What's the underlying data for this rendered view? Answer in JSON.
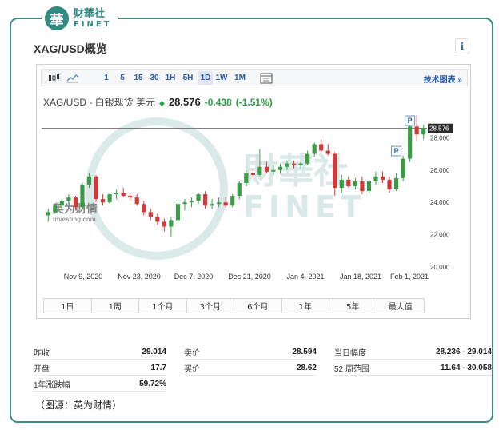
{
  "logo": {
    "badge_char": "華",
    "cn": "财華社",
    "en": "FINET"
  },
  "page_title": "XAG/USD概览",
  "info_label": "i",
  "toolbar": {
    "intervals": [
      "1",
      "5",
      "15",
      "30",
      "1H",
      "5H",
      "1D",
      "1W",
      "1M"
    ],
    "selected": "1D",
    "right_link": "技术图表 »"
  },
  "quote": {
    "symbol": "XAG/USD - 白银现货 美元",
    "arrow": "◆",
    "price": "28.576",
    "change": "-0.438",
    "change_pct": "(-1.51%)"
  },
  "chart_data": {
    "type": "candlestick",
    "x_ticks": [
      "Nov 9, 2020",
      "Nov 23, 2020",
      "Dec 7, 2020",
      "Dec 21, 2020",
      "Jan 4, 2021",
      "Jan 18, 2021",
      "Feb 1, 2021"
    ],
    "y_ticks": [
      "20.000",
      "22.000",
      "24.000",
      "26.000",
      "28.000"
    ],
    "ylim": [
      20,
      29.8
    ],
    "last_price_label": "28.576",
    "last_price": 28.576,
    "markers": [
      "P",
      "P"
    ],
    "watermark": {
      "cn": "財華社",
      "en": "FINET",
      "brand": "英为财情",
      "brand_en": "Investing.com"
    },
    "candles": [
      {
        "o": 23.2,
        "h": 23.6,
        "l": 22.8,
        "c": 23.4
      },
      {
        "o": 23.4,
        "h": 23.9,
        "l": 23.3,
        "c": 23.8
      },
      {
        "o": 23.8,
        "h": 24.2,
        "l": 23.6,
        "c": 24.1
      },
      {
        "o": 24.1,
        "h": 24.5,
        "l": 23.9,
        "c": 24.3
      },
      {
        "o": 24.3,
        "h": 24.4,
        "l": 23.5,
        "c": 23.7
      },
      {
        "o": 23.7,
        "h": 25.2,
        "l": 23.6,
        "c": 25.1
      },
      {
        "o": 25.1,
        "h": 25.8,
        "l": 24.9,
        "c": 25.6
      },
      {
        "o": 25.6,
        "h": 25.7,
        "l": 24.0,
        "c": 24.2
      },
      {
        "o": 24.2,
        "h": 24.5,
        "l": 23.8,
        "c": 24.0
      },
      {
        "o": 24.0,
        "h": 24.6,
        "l": 23.9,
        "c": 24.5
      },
      {
        "o": 24.5,
        "h": 24.8,
        "l": 24.2,
        "c": 24.6
      },
      {
        "o": 24.6,
        "h": 24.9,
        "l": 24.3,
        "c": 24.4
      },
      {
        "o": 24.4,
        "h": 24.6,
        "l": 24.1,
        "c": 24.3
      },
      {
        "o": 24.3,
        "h": 24.5,
        "l": 23.8,
        "c": 23.9
      },
      {
        "o": 23.9,
        "h": 24.1,
        "l": 23.2,
        "c": 23.4
      },
      {
        "o": 23.4,
        "h": 23.6,
        "l": 22.9,
        "c": 23.1
      },
      {
        "o": 23.1,
        "h": 23.3,
        "l": 22.6,
        "c": 22.8
      },
      {
        "o": 22.8,
        "h": 23.0,
        "l": 22.2,
        "c": 22.5
      },
      {
        "o": 22.5,
        "h": 23.1,
        "l": 21.9,
        "c": 22.9
      },
      {
        "o": 22.9,
        "h": 24.0,
        "l": 22.7,
        "c": 23.9
      },
      {
        "o": 23.9,
        "h": 24.2,
        "l": 23.5,
        "c": 24.0
      },
      {
        "o": 24.0,
        "h": 24.3,
        "l": 23.7,
        "c": 24.1
      },
      {
        "o": 24.1,
        "h": 24.6,
        "l": 23.9,
        "c": 24.5
      },
      {
        "o": 24.5,
        "h": 24.7,
        "l": 23.6,
        "c": 23.8
      },
      {
        "o": 23.8,
        "h": 24.2,
        "l": 23.6,
        "c": 23.9
      },
      {
        "o": 23.9,
        "h": 24.3,
        "l": 23.7,
        "c": 24.0
      },
      {
        "o": 24.0,
        "h": 24.3,
        "l": 23.7,
        "c": 23.8
      },
      {
        "o": 23.8,
        "h": 24.5,
        "l": 23.7,
        "c": 24.4
      },
      {
        "o": 24.4,
        "h": 25.3,
        "l": 24.2,
        "c": 25.2
      },
      {
        "o": 25.2,
        "h": 26.0,
        "l": 25.0,
        "c": 25.8
      },
      {
        "o": 25.8,
        "h": 26.1,
        "l": 25.5,
        "c": 25.7
      },
      {
        "o": 25.7,
        "h": 27.3,
        "l": 25.6,
        "c": 26.2
      },
      {
        "o": 26.2,
        "h": 26.5,
        "l": 25.8,
        "c": 25.9
      },
      {
        "o": 25.9,
        "h": 26.3,
        "l": 25.7,
        "c": 26.0
      },
      {
        "o": 26.0,
        "h": 26.4,
        "l": 25.8,
        "c": 26.2
      },
      {
        "o": 26.2,
        "h": 26.6,
        "l": 26.0,
        "c": 26.4
      },
      {
        "o": 26.4,
        "h": 26.6,
        "l": 26.1,
        "c": 26.3
      },
      {
        "o": 26.3,
        "h": 26.5,
        "l": 26.1,
        "c": 26.4
      },
      {
        "o": 26.4,
        "h": 27.2,
        "l": 26.3,
        "c": 27.0
      },
      {
        "o": 27.0,
        "h": 27.7,
        "l": 26.8,
        "c": 27.6
      },
      {
        "o": 27.6,
        "h": 27.9,
        "l": 27.1,
        "c": 27.2
      },
      {
        "o": 27.2,
        "h": 27.6,
        "l": 26.9,
        "c": 27.0
      },
      {
        "o": 27.0,
        "h": 27.1,
        "l": 24.4,
        "c": 24.9
      },
      {
        "o": 24.9,
        "h": 25.7,
        "l": 24.6,
        "c": 25.4
      },
      {
        "o": 25.4,
        "h": 25.6,
        "l": 24.9,
        "c": 25.0
      },
      {
        "o": 25.0,
        "h": 25.5,
        "l": 24.8,
        "c": 25.3
      },
      {
        "o": 25.3,
        "h": 25.6,
        "l": 24.5,
        "c": 24.7
      },
      {
        "o": 24.7,
        "h": 25.4,
        "l": 24.5,
        "c": 25.3
      },
      {
        "o": 25.3,
        "h": 25.9,
        "l": 25.1,
        "c": 25.6
      },
      {
        "o": 25.6,
        "h": 25.9,
        "l": 25.2,
        "c": 25.4
      },
      {
        "o": 25.4,
        "h": 25.6,
        "l": 24.6,
        "c": 24.8
      },
      {
        "o": 24.8,
        "h": 25.8,
        "l": 24.7,
        "c": 25.5
      },
      {
        "o": 25.5,
        "h": 26.9,
        "l": 25.3,
        "c": 26.7
      },
      {
        "o": 26.7,
        "h": 29.0,
        "l": 26.5,
        "c": 28.7
      },
      {
        "o": 28.7,
        "h": 29.4,
        "l": 27.8,
        "c": 28.2
      },
      {
        "o": 28.2,
        "h": 28.8,
        "l": 27.9,
        "c": 28.576
      }
    ]
  },
  "ranges": [
    "1日",
    "1周",
    "1个月",
    "3个月",
    "6个月",
    "1年",
    "5年",
    "最大值"
  ],
  "stats": {
    "col1": [
      {
        "label": "昨收",
        "value": "29.014"
      },
      {
        "label": "开盘",
        "value": "17.7"
      },
      {
        "label": "1年涨跌幅",
        "value": "59.72%"
      }
    ],
    "col2": [
      {
        "label": "卖价",
        "value": "28.594"
      },
      {
        "label": "买价",
        "value": "28.62"
      }
    ],
    "col3": [
      {
        "label": "当日幅度",
        "value": "28.236 - 29.014"
      },
      {
        "label": "52 周范围",
        "value": "11.64 - 30.058"
      }
    ]
  },
  "caption": "（图源：英为财情）",
  "colors": {
    "up": "#3a9c47",
    "down": "#d23a3a",
    "accent": "#2a5db0",
    "frame": "#3b8f86"
  }
}
